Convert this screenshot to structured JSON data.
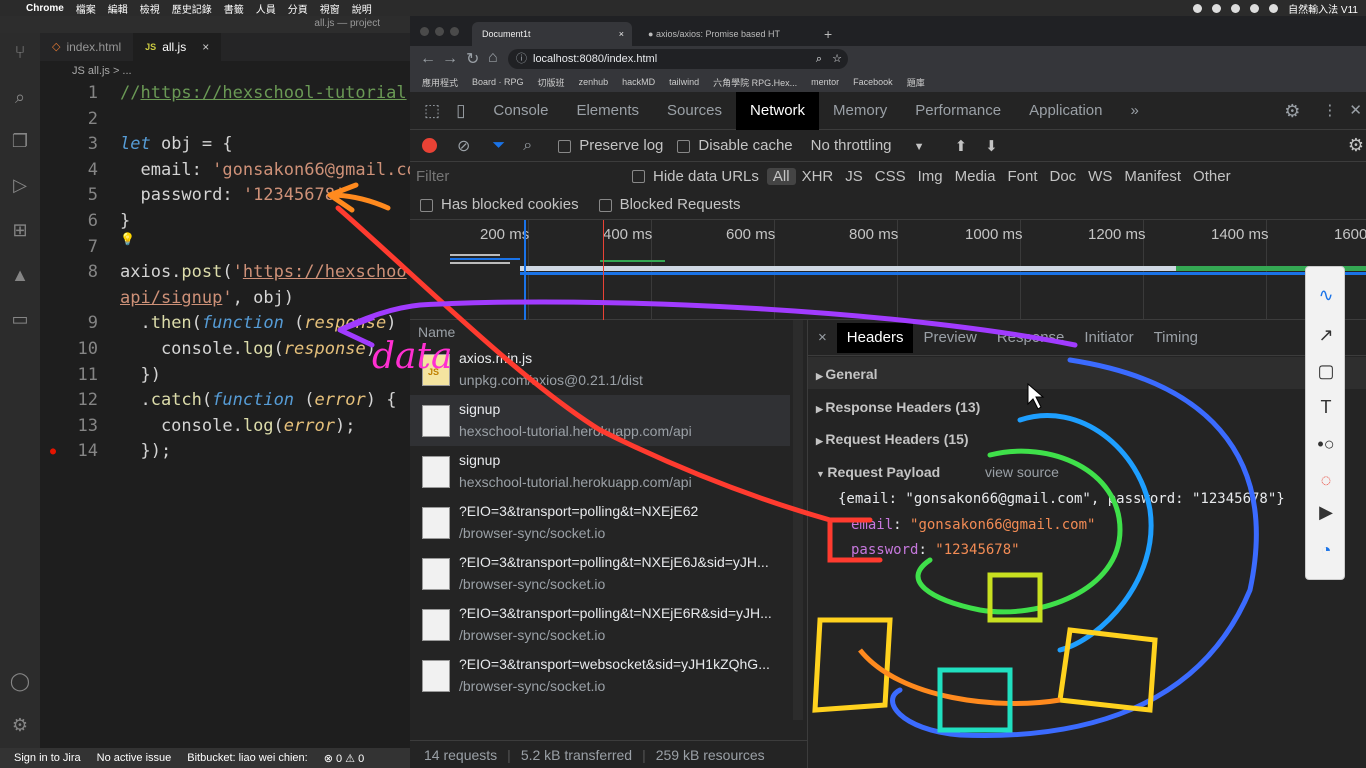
{
  "menubar": {
    "apple": "",
    "app": "Chrome",
    "items": [
      "檔案",
      "編輯",
      "檢視",
      "歷史記錄",
      "書籤",
      "人員",
      "分頁",
      "視窗",
      "說明"
    ],
    "ime": "自然輸入法 V11"
  },
  "vscode": {
    "title": "all.js — project",
    "tabs": [
      {
        "label": "index.html",
        "active": false
      },
      {
        "label": "all.js",
        "active": true,
        "icon": "JS"
      }
    ],
    "close": "×",
    "breadcrumb": "JS all.js > ...",
    "status": {
      "jira": "Sign in to Jira",
      "issue": "No active issue",
      "bitbucket": "Bitbucket: liao wei chien:",
      "errors": "0",
      "warnings": "0"
    }
  },
  "chrome": {
    "tabs": [
      {
        "label": "Document1t",
        "active": true
      },
      {
        "label": "axios/axios: Promise based HT",
        "active": false
      }
    ],
    "new_tab": "+",
    "url": "localhost:8080/index.html",
    "bookmarks": [
      "應用程式",
      "Board · RPG",
      "切版班",
      "zenhub",
      "hackMD",
      "tailwind",
      "六角學院 RPG.Hex...",
      "mentor",
      "Facebook",
      "題庫"
    ]
  },
  "devtools": {
    "tabs": [
      "Console",
      "Elements",
      "Sources",
      "Network",
      "Memory",
      "Performance",
      "Application",
      "»"
    ],
    "active_tab": "Network",
    "toolbar": {
      "preserve_log": "Preserve log",
      "disable_cache": "Disable cache",
      "throttling": "No throttling"
    },
    "filter": {
      "placeholder": "Filter",
      "hide_data_urls": "Hide data URLs",
      "types": [
        "All",
        "XHR",
        "JS",
        "CSS",
        "Img",
        "Media",
        "Font",
        "Doc",
        "WS",
        "Manifest",
        "Other"
      ]
    },
    "blocked": {
      "cookies": "Has blocked cookies",
      "requests": "Blocked Requests"
    },
    "timeline_ticks": [
      "200 ms",
      "400 ms",
      "600 ms",
      "800 ms",
      "1000 ms",
      "1200 ms",
      "1400 ms",
      "1600"
    ],
    "name_header": "Name",
    "requests": [
      {
        "name": "axios.min.js",
        "path": "unpkg.com/axios@0.21.1/dist",
        "type": "js"
      },
      {
        "name": "signup",
        "path": "hexschool-tutorial.herokuapp.com/api",
        "type": "doc"
      },
      {
        "name": "signup",
        "path": "hexschool-tutorial.herokuapp.com/api",
        "type": "doc"
      },
      {
        "name": "?EIO=3&transport=polling&t=NXEjE62",
        "path": "/browser-sync/socket.io",
        "type": "doc"
      },
      {
        "name": "?EIO=3&transport=polling&t=NXEjE6J&sid=yJH...",
        "path": "/browser-sync/socket.io",
        "type": "doc"
      },
      {
        "name": "?EIO=3&transport=polling&t=NXEjE6R&sid=yJH...",
        "path": "/browser-sync/socket.io",
        "type": "doc"
      },
      {
        "name": "?EIO=3&transport=websocket&sid=yJH1kZQhG...",
        "path": "/browser-sync/socket.io",
        "type": "doc"
      }
    ],
    "detail_tabs": [
      "×",
      "Headers",
      "Preview",
      "Response",
      "Initiator",
      "Timing"
    ],
    "detail_active": "Headers",
    "sections": {
      "general": "General",
      "response_headers": "Response Headers (13)",
      "request_headers": "Request Headers (15)",
      "request_payload": "Request Payload",
      "view_source": "view source"
    },
    "payload": {
      "summary": "{email: \"gonsakon66@gmail.com\", password: \"12345678\"}",
      "email_key": "email",
      "email_val": "\"gonsakon66@gmail.com\"",
      "password_key": "password",
      "password_val": "\"12345678\""
    },
    "status": {
      "requests": "14 requests",
      "transferred": "5.2 kB transferred",
      "resources": "259 kB resources"
    }
  },
  "annotation_text": "data",
  "colors": {
    "accent_red": "#e94235",
    "network_blue": "#1a73e8"
  }
}
